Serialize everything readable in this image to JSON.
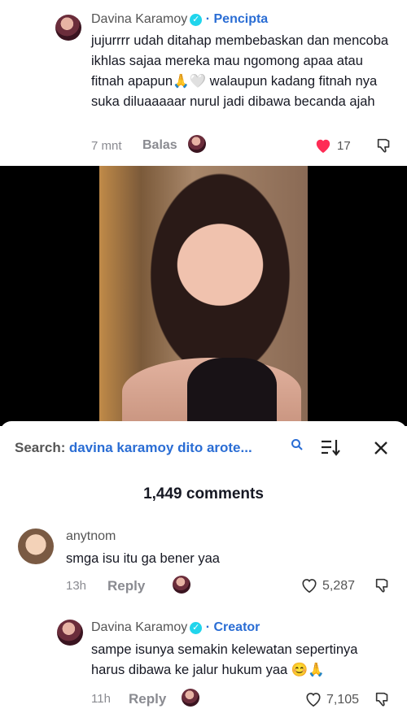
{
  "top_comment": {
    "author": "Davina Karamoy",
    "role": "Pencipta",
    "text": "jujurrrr udah ditahap membebaskan dan mencoba ikhlas sajaa mereka mau ngomong apaa atau fitnah apapun🙏🤍 walaupun kadang fitnah nya suka diluaaaaar nurul jadi dibawa becanda ajah",
    "time": "7 mnt",
    "reply_label": "Balas",
    "likes": "17",
    "like_color": "#fe2c55"
  },
  "search": {
    "label": "Search:",
    "query": "davina karamoy dito arote..."
  },
  "comments_header": "1,449 comments",
  "comments": [
    {
      "author": "anytnom",
      "text": "smga isu itu ga bener yaa",
      "time": "13h",
      "reply_label": "Reply",
      "likes": "5,287"
    },
    {
      "author": "Davina Karamoy",
      "role": "Creator",
      "text": "sampe isunya semakin kelewatan sepertinya harus dibawa ke jalur hukum yaa 😊🙏",
      "time": "11h",
      "reply_label": "Reply",
      "likes": "7,105"
    }
  ],
  "icons": {
    "verified": "verified-badge-icon",
    "heart": "heart-icon",
    "dislike": "dislike-icon",
    "sort": "sort-icon",
    "close": "close-icon",
    "search": "search-icon"
  }
}
